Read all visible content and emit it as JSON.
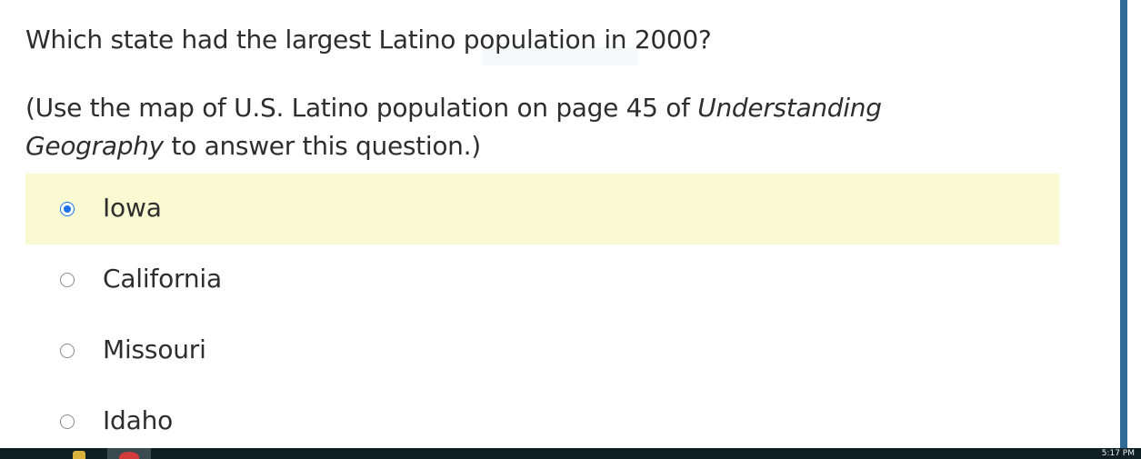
{
  "question": {
    "text": "Which state had the largest Latino population in 2000?",
    "instruction_before": "(Use the map of U.S. Latino population on page 45 of ",
    "instruction_italic": "Understanding Geography",
    "instruction_after": " to answer this question.)"
  },
  "options": [
    {
      "label": "Iowa",
      "selected": true
    },
    {
      "label": "California",
      "selected": false
    },
    {
      "label": "Missouri",
      "selected": false
    },
    {
      "label": "Idaho",
      "selected": false
    }
  ],
  "taskbar": {
    "clock": "5:17 PM"
  },
  "colors": {
    "selected_background": "#fafad2",
    "radio_accent": "#1a73e8",
    "side_rail": "#2f6b95",
    "taskbar": "#0f1f24"
  }
}
